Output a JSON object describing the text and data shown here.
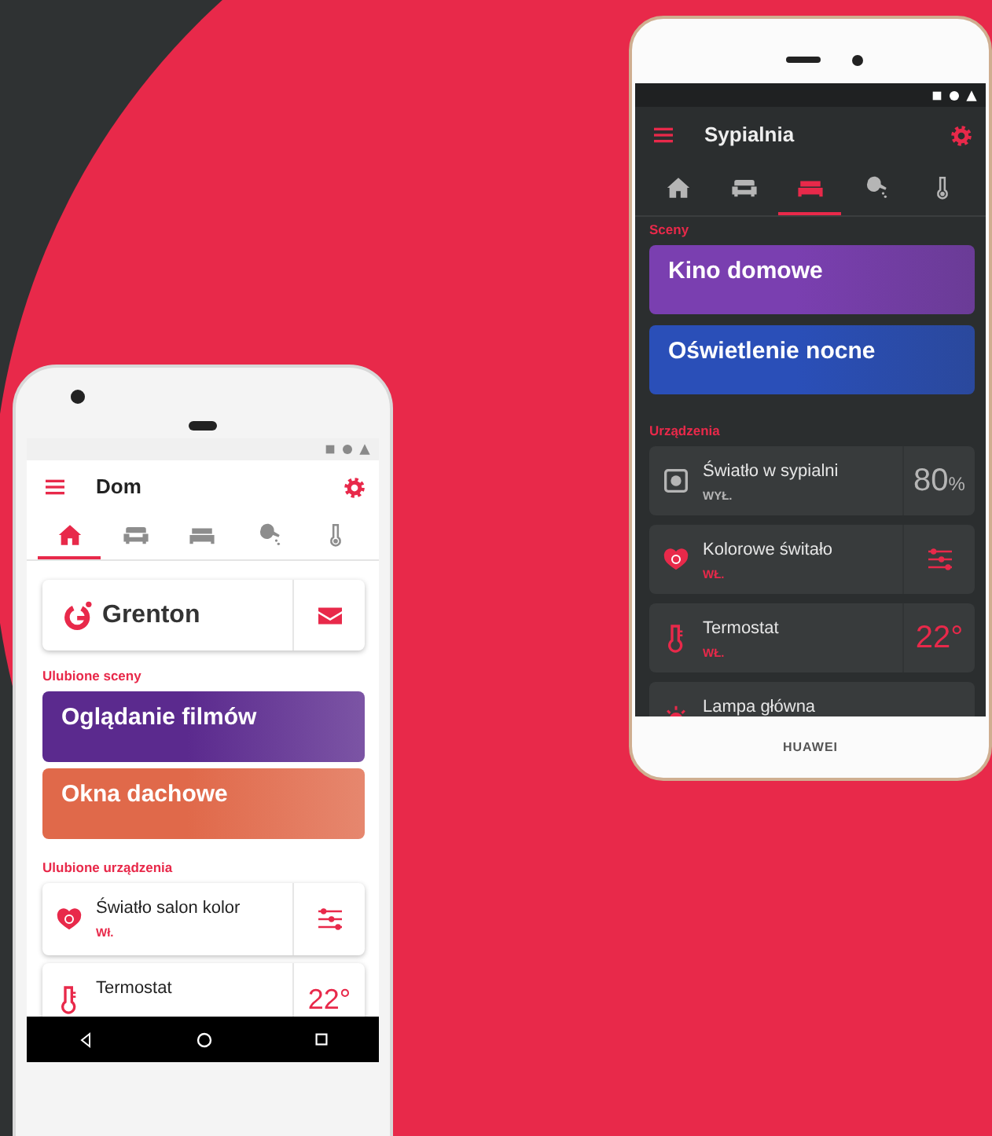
{
  "phones": [
    {
      "dark_mode": false,
      "title": "Dom",
      "tabs": [
        {
          "kind": "home",
          "selected": true
        },
        {
          "kind": "armchair",
          "selected": false
        },
        {
          "kind": "bed",
          "selected": false
        },
        {
          "kind": "watering-can",
          "selected": false
        },
        {
          "kind": "thermometer",
          "selected": false
        }
      ],
      "brand_card": {
        "logo_text": "Grenton"
      },
      "sections": [
        {
          "title": "Ulubione sceny",
          "kind": "scenes",
          "items": [
            {
              "label": "Oglądanie filmów",
              "color": "#5b2a8e"
            },
            {
              "label": "Okna dachowe",
              "color": "#e0694a"
            }
          ]
        },
        {
          "title": "Ulubione urządzenia",
          "kind": "devices",
          "items": [
            {
              "kind": "color-light",
              "name": "Światło salon kolor",
              "status": "Wł.",
              "on": true,
              "control": {
                "kind": "sliders"
              }
            },
            {
              "kind": "thermostat",
              "name": "Termostat",
              "on": true,
              "control": {
                "kind": "value",
                "value": "22°"
              }
            }
          ]
        }
      ],
      "nav_bar": true
    },
    {
      "dark_mode": true,
      "title": "Sypialnia",
      "tabs": [
        {
          "kind": "home",
          "selected": false
        },
        {
          "kind": "armchair",
          "selected": false
        },
        {
          "kind": "bed",
          "selected": true
        },
        {
          "kind": "watering-can",
          "selected": false
        },
        {
          "kind": "thermometer",
          "selected": false
        }
      ],
      "sections": [
        {
          "title": "Sceny",
          "kind": "scenes",
          "items": [
            {
              "label": "Kino domowe",
              "color": "#7a3fb0"
            },
            {
              "label": "Oświetlenie nocne",
              "color": "#2a4fb8"
            }
          ]
        },
        {
          "title": "Urządzenia",
          "kind": "devices",
          "items": [
            {
              "kind": "dimmer",
              "name": "Światło w sypialni",
              "status": "WYŁ.",
              "on": false,
              "control": {
                "kind": "value",
                "value": "80",
                "unit": "%"
              }
            },
            {
              "kind": "color-light",
              "name": "Kolorowe świtało",
              "status": "WŁ.",
              "on": true,
              "control": {
                "kind": "sliders"
              }
            },
            {
              "kind": "thermostat",
              "name": "Termostat",
              "status": "WŁ.",
              "on": true,
              "control": {
                "kind": "value",
                "value": "22°"
              }
            },
            {
              "kind": "lamp",
              "name": "Lampa główna",
              "on": true
            }
          ]
        }
      ],
      "brand": "HUAWEI"
    }
  ]
}
